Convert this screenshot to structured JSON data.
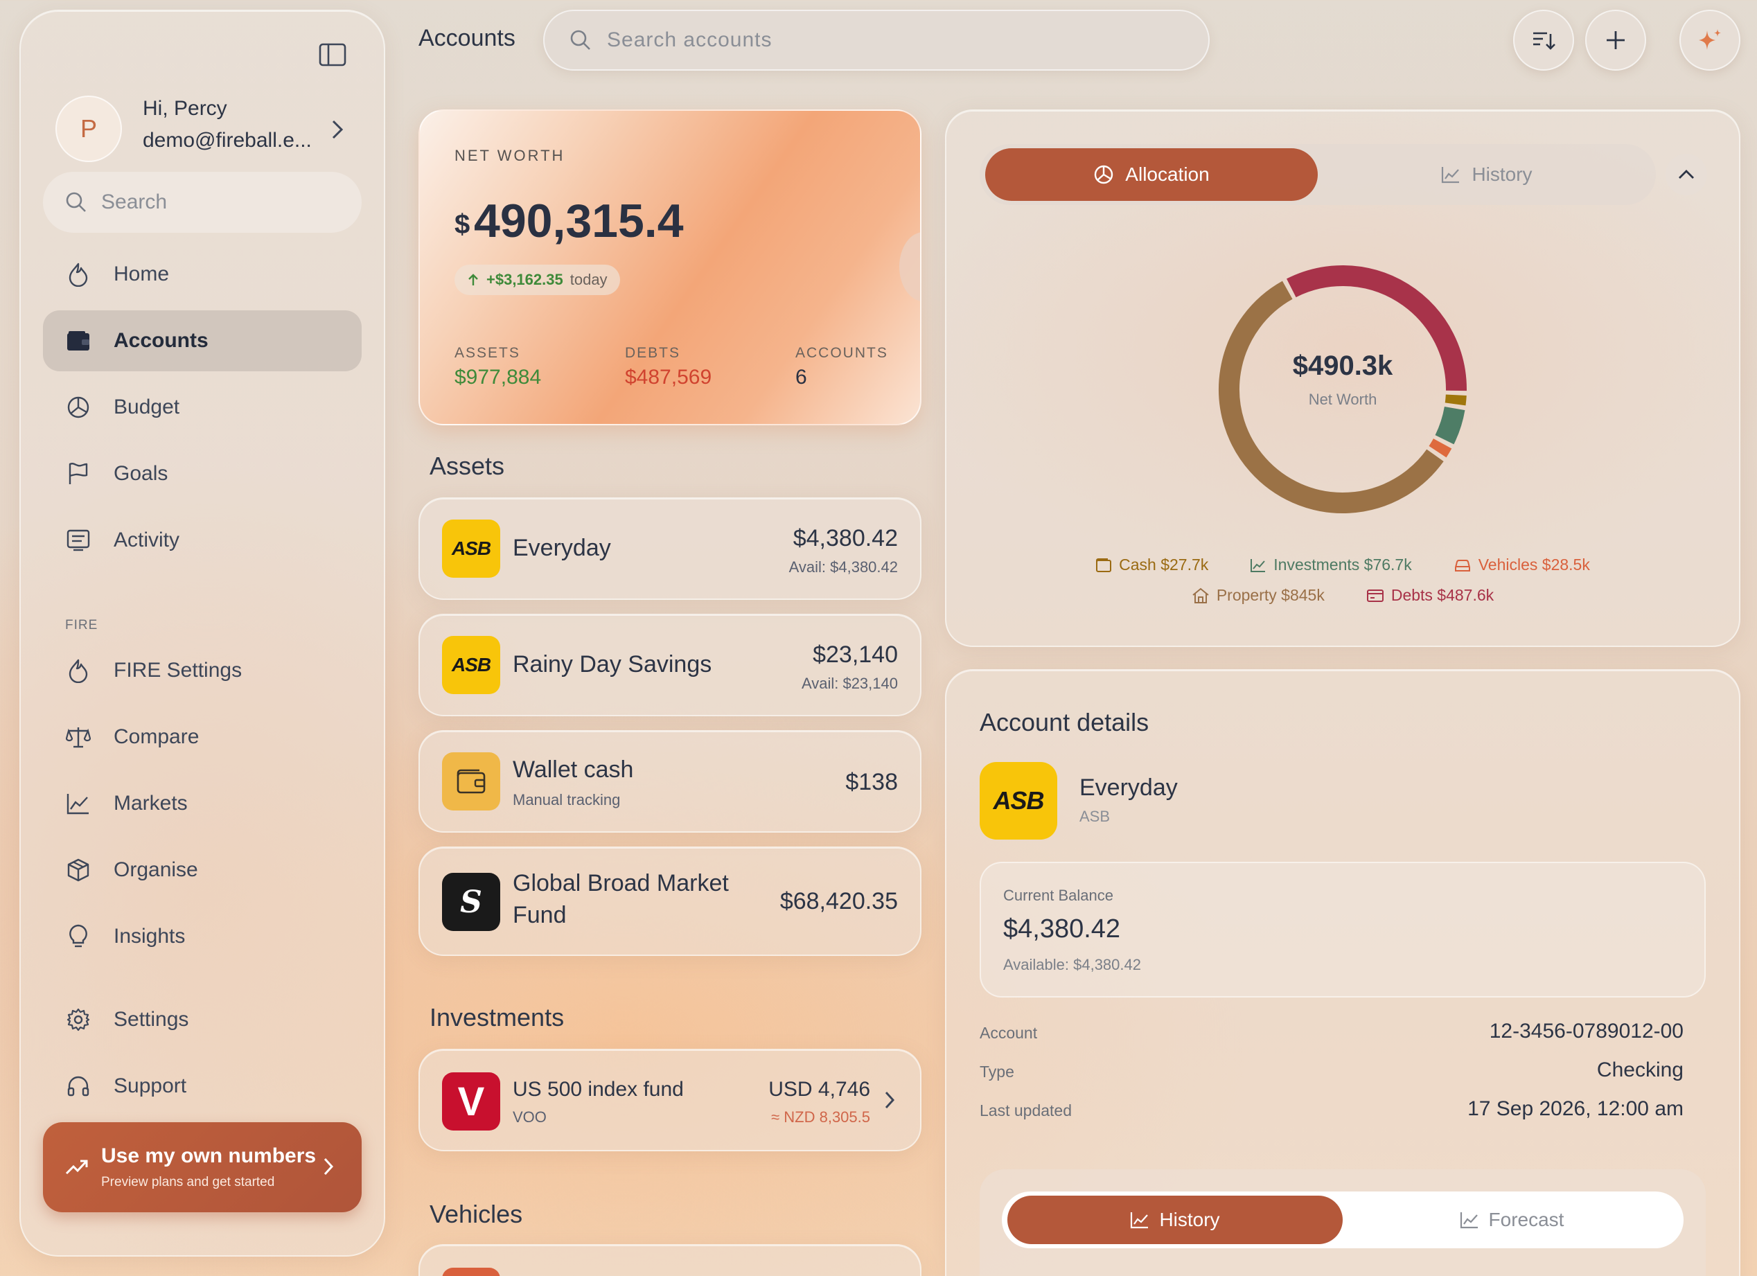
{
  "sidebar": {
    "user": {
      "initial": "P",
      "greeting": "Hi, Percy",
      "email": "demo@fireball.e..."
    },
    "search_placeholder": "Search",
    "nav": [
      {
        "label": "Home",
        "icon": "flame-icon"
      },
      {
        "label": "Accounts",
        "icon": "wallet-icon",
        "active": true
      },
      {
        "label": "Budget",
        "icon": "pie-icon"
      },
      {
        "label": "Goals",
        "icon": "flag-icon"
      },
      {
        "label": "Activity",
        "icon": "list-icon"
      }
    ],
    "fire_section_label": "FIRE",
    "fire_nav": [
      {
        "label": "FIRE Settings",
        "icon": "flame-icon"
      },
      {
        "label": "Compare",
        "icon": "scale-icon"
      },
      {
        "label": "Markets",
        "icon": "chart-icon"
      },
      {
        "label": "Organise",
        "icon": "box-icon"
      },
      {
        "label": "Insights",
        "icon": "lightbulb-icon"
      }
    ],
    "bottom_nav": [
      {
        "label": "Settings",
        "icon": "gear-icon"
      },
      {
        "label": "Support",
        "icon": "headset-icon"
      }
    ],
    "cta": {
      "title": "Use my own numbers",
      "subtitle": "Preview plans and get started"
    }
  },
  "header": {
    "title": "Accounts",
    "search_placeholder": "Search accounts"
  },
  "net_worth": {
    "label": "NET WORTH",
    "currency": "$",
    "value": "490,315.4",
    "change": "+$3,162.35",
    "change_suffix": "today",
    "assets_label": "ASSETS",
    "assets_value": "$977,884",
    "debts_label": "DEBTS",
    "debts_value": "$487,569",
    "accounts_label": "ACCOUNTS",
    "accounts_value": "6"
  },
  "assets": {
    "title": "Assets",
    "items": [
      {
        "logo": "ASB",
        "name": "Everyday",
        "value": "$4,380.42",
        "avail": "Avail: $4,380.42"
      },
      {
        "logo": "ASB",
        "name": "Rainy Day Savings",
        "value": "$23,140",
        "avail": "Avail: $23,140"
      },
      {
        "name": "Wallet cash",
        "sub": "Manual tracking",
        "value": "$138"
      },
      {
        "logo": "S",
        "name_line1": "Global Broad Market",
        "name_line2": "Fund",
        "value": "$68,420.35"
      }
    ]
  },
  "investments": {
    "title": "Investments",
    "items": [
      {
        "logo": "V",
        "name": "US 500 index fund",
        "ticker": "VOO",
        "value": "USD 4,746",
        "converted": "≈ NZD 8,305.5"
      }
    ]
  },
  "vehicles": {
    "title": "Vehicles"
  },
  "allocation": {
    "tab_allocation": "Allocation",
    "tab_history": "History",
    "center_value": "$490.3k",
    "center_label": "Net Worth",
    "legend": [
      {
        "label": "Cash $27.7k",
        "color": "#9a6a12",
        "icon": "wallet-icon"
      },
      {
        "label": "Investments $76.7k",
        "color": "#4e7a63",
        "icon": "chart-icon"
      },
      {
        "label": "Vehicles $28.5k",
        "color": "#d9603c",
        "icon": "car-icon"
      },
      {
        "label": "Property $845k",
        "color": "#9a7048",
        "icon": "house-icon"
      },
      {
        "label": "Debts $487.6k",
        "color": "#a83248",
        "icon": "card-icon"
      }
    ],
    "segments": [
      {
        "name": "Debts",
        "value": 487.6,
        "color": "#a8334a"
      },
      {
        "name": "Cash",
        "value": 27.7,
        "color": "#a0760c"
      },
      {
        "name": "Investments",
        "value": 76.7,
        "color": "#4e7d66"
      },
      {
        "name": "Vehicles",
        "value": 28.5,
        "color": "#de6a3e"
      },
      {
        "name": "Property",
        "value": 845,
        "color": "#9b7246"
      }
    ]
  },
  "details": {
    "title": "Account details",
    "name": "Everyday",
    "bank": "ASB",
    "logo": "ASB",
    "balance_label": "Current Balance",
    "balance": "$4,380.42",
    "available": "Available: $4,380.42",
    "rows": [
      {
        "label": "Account",
        "value": "12-3456-0789012-00"
      },
      {
        "label": "Type",
        "value": "Checking"
      },
      {
        "label": "Last updated",
        "value": "17 Sep 2026, 12:00 am"
      }
    ],
    "tab_history": "History",
    "tab_forecast": "Forecast"
  },
  "colors": {
    "accent": "#b4583a",
    "positive": "#3f8a3a",
    "negative": "#d0432f"
  }
}
